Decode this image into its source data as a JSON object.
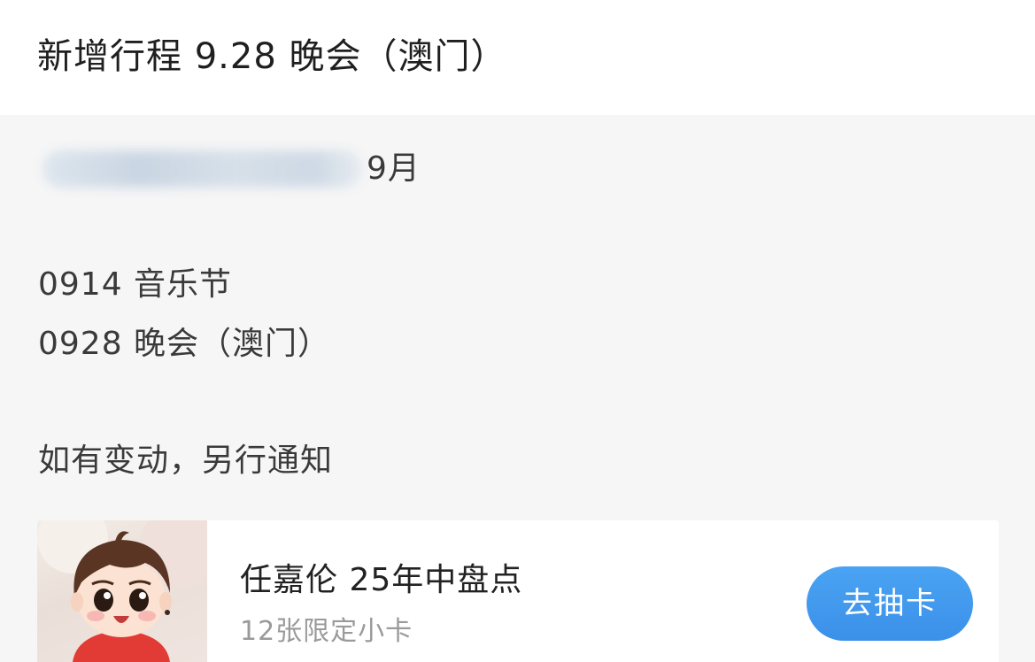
{
  "header": {
    "title": "新增行程  9.28 晚会（澳门）"
  },
  "post": {
    "month_line": "9月",
    "schedule": [
      "0914 音乐节",
      "0928 晚会（澳门）"
    ],
    "notice": "如有变动，另行通知"
  },
  "promo_card": {
    "title": "任嘉伦 25年中盘点",
    "subtitle": "12张限定小卡",
    "button_label": "去抽卡",
    "button_color": "#3b90e8"
  }
}
